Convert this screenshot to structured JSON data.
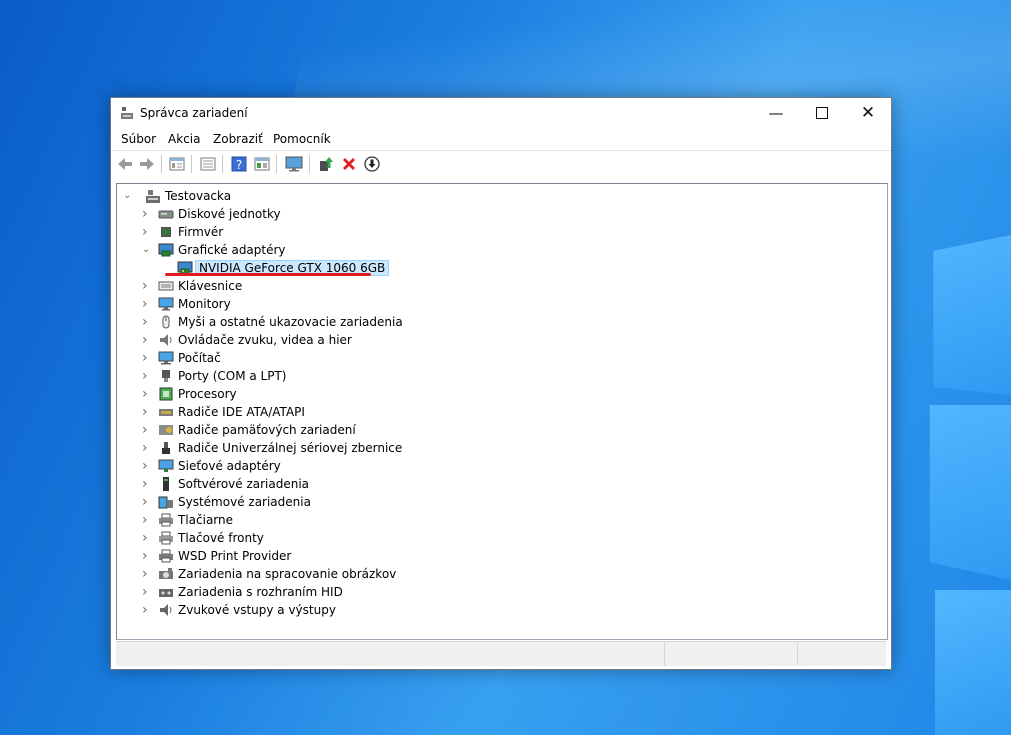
{
  "window": {
    "title": "Správca zariadení"
  },
  "menu": [
    "Súbor",
    "Akcia",
    "Zobraziť",
    "Pomocník"
  ],
  "toolbar": [
    "back-icon",
    "forward-icon",
    "properties-list-icon",
    "console-tree-icon",
    "help-icon",
    "view-details-icon",
    "scan-hardware-icon",
    "update-driver-icon",
    "uninstall-icon",
    "disable-device-icon"
  ],
  "tree": {
    "root": "Testovacka",
    "items": [
      {
        "label": "Diskové jednotky",
        "icon": "disk-icon"
      },
      {
        "label": "Firmvér",
        "icon": "firmware-icon"
      },
      {
        "label": "Grafické adaptéry",
        "icon": "display-adapter-icon",
        "expanded": true,
        "children": [
          {
            "label": "NVIDIA GeForce GTX 1060 6GB",
            "icon": "gpu-icon",
            "selected": true
          }
        ]
      },
      {
        "label": "Klávesnice",
        "icon": "keyboard-icon"
      },
      {
        "label": "Monitory",
        "icon": "monitor-icon"
      },
      {
        "label": "Myši a ostatné ukazovacie zariadenia",
        "icon": "mouse-icon"
      },
      {
        "label": "Ovládače zvuku, videa a hier",
        "icon": "speaker-icon"
      },
      {
        "label": "Počítač",
        "icon": "computer-icon"
      },
      {
        "label": "Porty (COM a LPT)",
        "icon": "port-icon"
      },
      {
        "label": "Procesory",
        "icon": "cpu-icon"
      },
      {
        "label": "Radiče IDE ATA/ATAPI",
        "icon": "ide-controller-icon"
      },
      {
        "label": "Radiče pamäťových zariadení",
        "icon": "storage-controller-icon"
      },
      {
        "label": "Radiče Univerzálnej sériovej zbernice",
        "icon": "usb-icon"
      },
      {
        "label": "Sieťové adaptéry",
        "icon": "network-icon"
      },
      {
        "label": "Softvérové zariadenia",
        "icon": "software-device-icon"
      },
      {
        "label": "Systémové zariadenia",
        "icon": "system-device-icon"
      },
      {
        "label": "Tlačiarne",
        "icon": "printer-icon"
      },
      {
        "label": "Tlačové fronty",
        "icon": "print-queue-icon"
      },
      {
        "label": "WSD Print Provider",
        "icon": "wsd-printer-icon"
      },
      {
        "label": "Zariadenia na spracovanie obrázkov",
        "icon": "camera-icon"
      },
      {
        "label": "Zariadenia s rozhraním HID",
        "icon": "hid-icon"
      },
      {
        "label": "Zvukové vstupy a výstupy",
        "icon": "audio-io-icon"
      }
    ]
  },
  "colors": {
    "accent_underline": "#e01b24",
    "selection_bg": "#cce8ff",
    "uninstall_red": "#e02020"
  }
}
